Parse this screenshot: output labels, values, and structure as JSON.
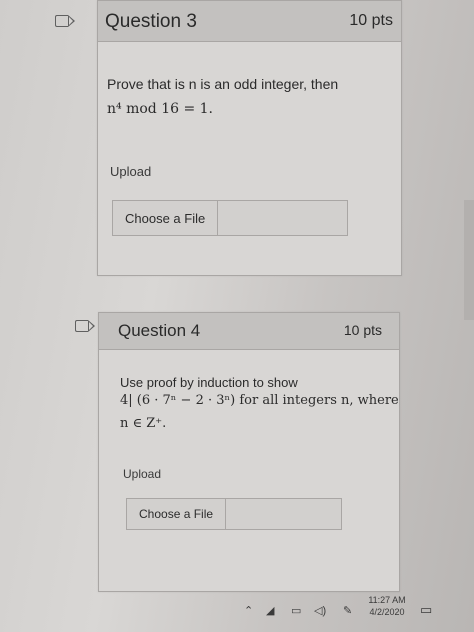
{
  "questions": [
    {
      "title": "Question 3",
      "points": "10 pts",
      "prompt": "Prove that is n is an odd integer, then",
      "math": "n⁴  mod 16 = 1.",
      "upload_label": "Upload",
      "file_button": "Choose a File"
    },
    {
      "title": "Question 4",
      "points": "10 pts",
      "prompt": "Use proof by induction to show",
      "math_line1": "4| (6 · 7ⁿ − 2 · 3ⁿ) for all integers n, where",
      "math_line2": "n ∈ Z⁺.",
      "upload_label": "Upload",
      "file_button": "Choose a File"
    }
  ],
  "taskbar": {
    "time": "11:27 AM",
    "date": "4/2/2020",
    "tray_icons": [
      "chevron-up-icon",
      "wifi-icon",
      "battery-icon",
      "volume-icon",
      "pen-icon",
      "notification-icon"
    ]
  }
}
